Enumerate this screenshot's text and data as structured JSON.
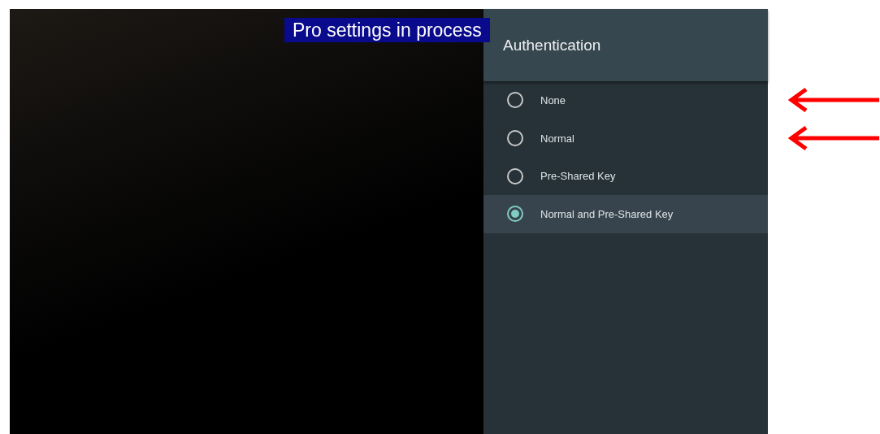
{
  "banner": {
    "text": "Pro settings in process"
  },
  "panel": {
    "title": "Authentication",
    "options": [
      {
        "label": "None",
        "selected": false,
        "arrow": true
      },
      {
        "label": "Normal",
        "selected": false,
        "arrow": true
      },
      {
        "label": "Pre-Shared Key",
        "selected": false,
        "arrow": false
      },
      {
        "label": "Normal and Pre-Shared Key",
        "selected": true,
        "arrow": false
      }
    ]
  }
}
